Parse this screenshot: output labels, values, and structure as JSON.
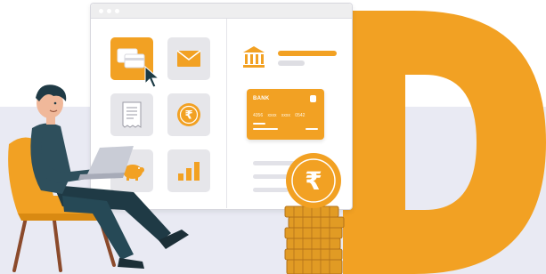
{
  "colors": {
    "accent": "#f2a123",
    "accent_dark": "#d98a12",
    "background_band": "#e9eaf3",
    "tile_bg": "#e6e6ea",
    "window_border": "#d7d7de"
  },
  "hero_letter": "D",
  "window": {
    "controls": [
      "dot",
      "dot",
      "dot"
    ],
    "tiles": [
      {
        "icon": "credit-cards-icon",
        "active": true
      },
      {
        "icon": "envelope-icon",
        "active": false
      },
      {
        "icon": "receipt-icon",
        "active": false
      },
      {
        "icon": "rupee-coin-icon",
        "active": false
      },
      {
        "icon": "piggy-bank-icon",
        "active": false
      },
      {
        "icon": "bar-chart-icon",
        "active": false
      }
    ],
    "card": {
      "bank_label": "BANK",
      "number": "4356 xxxx xxxx 0542"
    },
    "currency_symbol": "₹"
  },
  "illustration": {
    "person": "man-with-laptop",
    "chair": "orange-armchair"
  }
}
